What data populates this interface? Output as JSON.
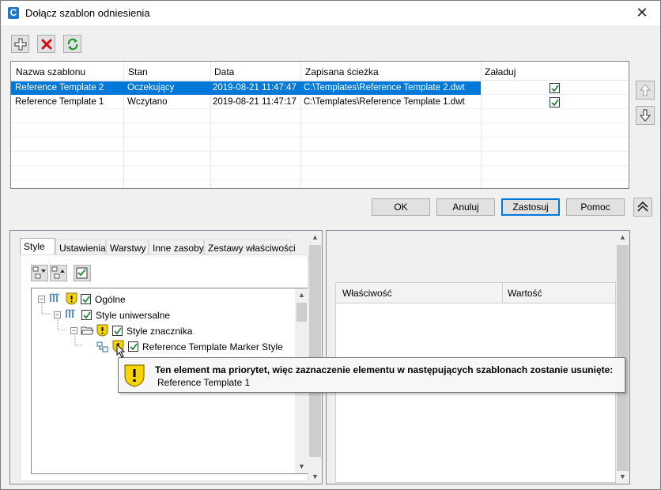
{
  "window": {
    "title": "Dołącz szablon odniesienia",
    "close_glyph": "✕"
  },
  "toolbar": {
    "add_icon": "plus-icon",
    "delete_icon": "delete-x-icon",
    "refresh_icon": "refresh-icon"
  },
  "templates": {
    "columns": [
      "Nazwa szablonu",
      "Stan",
      "Data",
      "Zapisana ścieżka",
      "Załaduj"
    ],
    "rows": [
      {
        "name": "Reference Template 2",
        "status": "Oczekujący",
        "date": "2019-08-21 11:47:47",
        "path": "C:\\Templates\\Reference Template 2.dwt",
        "load": true,
        "selected": true
      },
      {
        "name": "Reference Template 1",
        "status": "Wczytano",
        "date": "2019-08-21 11:47:17",
        "path": "C:\\Templates\\Reference Template 1.dwt",
        "load": true,
        "selected": false
      }
    ]
  },
  "buttons": {
    "ok": "OK",
    "cancel": "Anuluj",
    "apply": "Zastosuj",
    "help": "Pomoc"
  },
  "tabs": [
    "Style",
    "Ustawienia",
    "Warstwy",
    "Inne zasoby",
    "Zestawy właściwości"
  ],
  "tree": {
    "items": [
      {
        "label": "Ogólne",
        "checked": true
      },
      {
        "label": "Style uniwersalne",
        "checked": true
      },
      {
        "label": "Style znacznika",
        "checked": true
      },
      {
        "label": "Reference Template Marker Style",
        "checked": true
      }
    ]
  },
  "properties": {
    "columns": [
      "Właściwość",
      "Wartość"
    ]
  },
  "tooltip": {
    "title": "Ten element ma priorytet, więc zaznaczenie elementu w następujących szablonach zostanie usunięte:",
    "body": "Reference Template 1"
  },
  "colors": {
    "selection": "#0078d7",
    "warning_yellow": "#f5d400",
    "check_green": "#1a8c3a"
  }
}
